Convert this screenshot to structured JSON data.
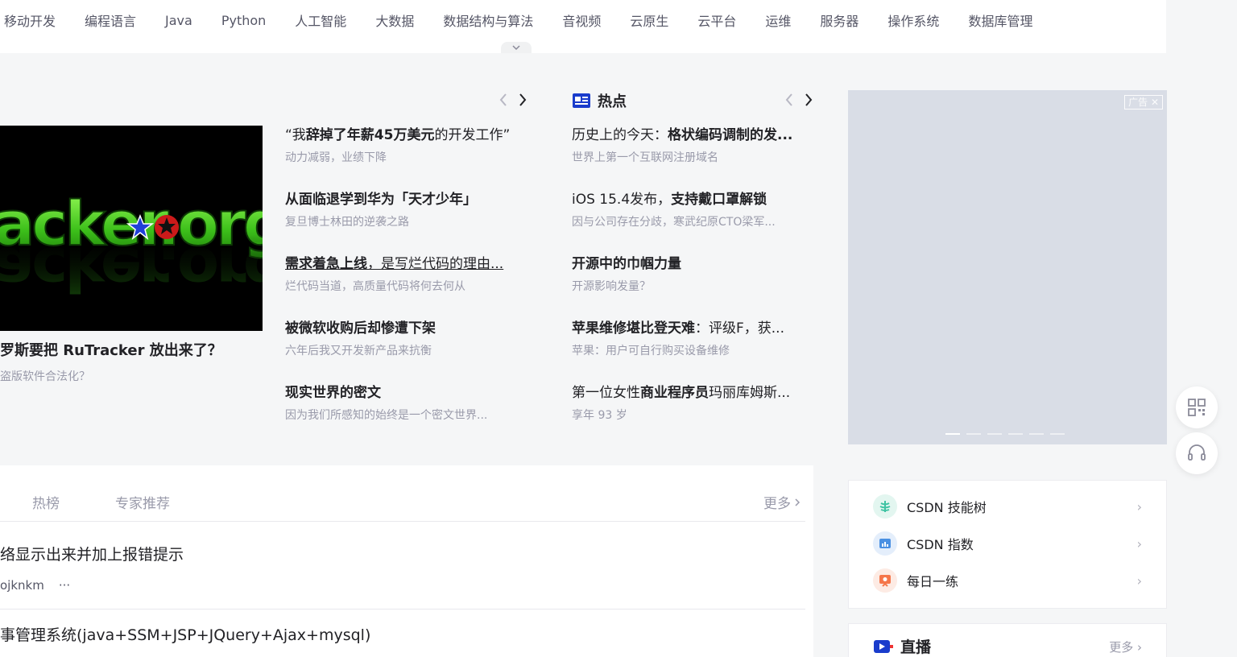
{
  "nav": {
    "items": [
      "移动开发",
      "编程语言",
      "Java",
      "Python",
      "人工智能",
      "大数据",
      "数据结构与算法",
      "音视频",
      "云原生",
      "云平台",
      "运维",
      "服务器",
      "操作系统",
      "数据库管理"
    ]
  },
  "feature": {
    "title": "罗斯要把 RuTracker 放出来了？",
    "subtitle": "盗版软件合法化？",
    "image_text": "acker.org"
  },
  "news": [
    {
      "pre": "“我",
      "bold": "辞掉了年薪45万美元",
      "post": "的开发工作”",
      "sub": "动力减弱，业绩下降"
    },
    {
      "pre": "",
      "bold": "从面临退学到华为「天才少年」",
      "post": "",
      "sub": "复旦博士林田的逆袭之路"
    },
    {
      "pre": "",
      "bold": "需求着急上线",
      "post": "，是写烂代码的理由...",
      "sub": "烂代码当道，高质量代码将何去何从"
    },
    {
      "pre": "",
      "bold": "被微软收购后却惨遭下架",
      "post": "",
      "sub": "六年后我又开发新产品来抗衡"
    },
    {
      "pre": "",
      "bold": "现实世界的密文",
      "post": "",
      "sub": "因为我们所感知的始终是一个密文世界..."
    }
  ],
  "hot": {
    "heading": "热点",
    "items": [
      {
        "pre": "历史上的今天：",
        "bold": "格状编码调制的发...",
        "post": "",
        "sub": "世界上第一个互联网注册域名"
      },
      {
        "pre": "iOS 15.4发布，",
        "bold": "支持戴口罩解锁",
        "post": "",
        "sub": "因与公司存在分歧，寒武纪原CTO梁军..."
      },
      {
        "pre": "",
        "bold": "开源中的巾帼力量",
        "post": "",
        "sub": "开源影响发量？"
      },
      {
        "pre": "",
        "bold": "苹果维修堪比登天难",
        "post": "：评级F，获...",
        "sub": "苹果：用户可自行购买设备维修"
      },
      {
        "pre": "第一位女性",
        "bold": "商业程序员",
        "post": "玛丽库姆斯...",
        "sub": "享年 93 岁"
      }
    ]
  },
  "ad": {
    "label": "广告",
    "dot_count": 6,
    "active_dot": 0
  },
  "lower": {
    "tabs": [
      "热榜",
      "专家推荐"
    ],
    "more": "更多",
    "rows": [
      {
        "title": "络显示出来并加上报错提示",
        "meta": [
          "ojknkm",
          "···"
        ]
      },
      {
        "title": "事管理系统(java+SSM+JSP+JQuery+Ajax+mysql)"
      }
    ]
  },
  "tools": {
    "items": [
      {
        "label": "CSDN 技能树",
        "icon": "skill-tree-icon",
        "color": "#3ec3a3"
      },
      {
        "label": "CSDN 指数",
        "icon": "index-chart-icon",
        "color": "#4a90e2"
      },
      {
        "label": "每日一练",
        "icon": "daily-practice-icon",
        "color": "#f5764a"
      }
    ]
  },
  "live": {
    "heading": "直播",
    "more": "更多"
  },
  "colors": {
    "brand_blue": "#1a3ccc",
    "text": "#222226",
    "muted": "#999aaa"
  }
}
